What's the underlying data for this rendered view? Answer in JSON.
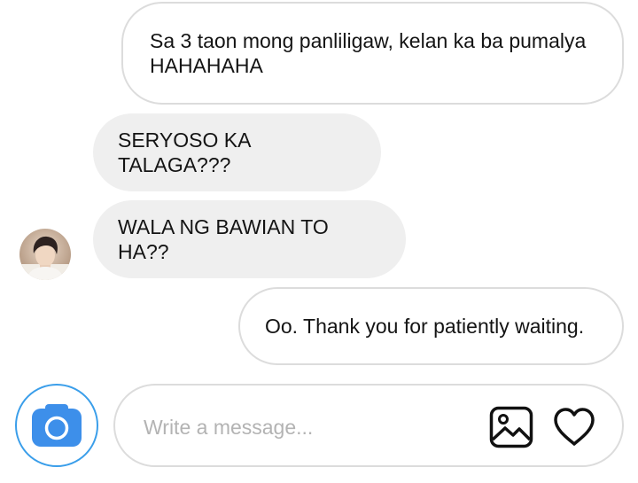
{
  "messages": [
    {
      "sender": "me",
      "text": "Sa 3 taon mong panliligaw, kelan ka ba pumalya HAHAHAHA"
    },
    {
      "sender": "them",
      "text": "SERYOSO KA TALAGA???"
    },
    {
      "sender": "them",
      "text": "WALA NG BAWIAN TO HA??"
    },
    {
      "sender": "me",
      "text": "Oo. Thank you for patiently waiting."
    }
  ],
  "composer": {
    "placeholder": "Write a message...",
    "camera_icon": "camera-icon",
    "gallery_icon": "image-gallery-icon",
    "like_icon": "heart-icon"
  },
  "colors": {
    "accent": "#3d8fea",
    "incoming_bubble": "#efefef",
    "outgoing_border": "#dcdcdc"
  }
}
